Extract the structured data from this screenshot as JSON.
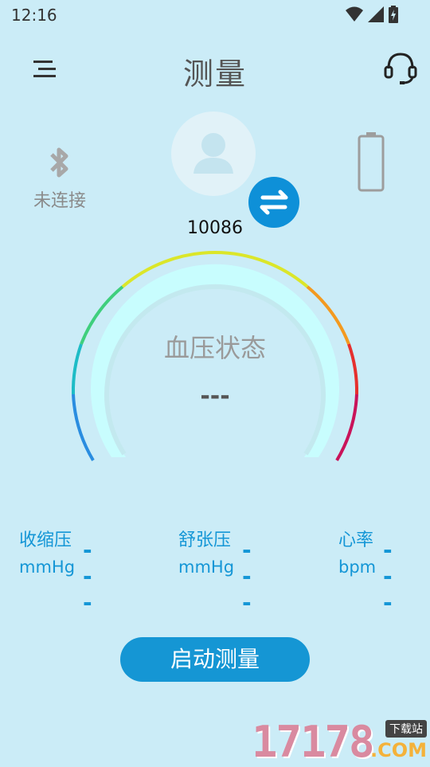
{
  "status_bar": {
    "time": "12:16"
  },
  "header": {
    "title": "测量"
  },
  "bluetooth": {
    "label": "未连接"
  },
  "user": {
    "id": "10086"
  },
  "gauge": {
    "status_label": "血压状态",
    "value": "---"
  },
  "metrics": [
    {
      "name": "收缩压",
      "unit": "mmHg",
      "value": "---"
    },
    {
      "name": "舒张压",
      "unit": "mmHg",
      "value": "---"
    },
    {
      "name": "心率",
      "unit": "bpm",
      "value": "---"
    }
  ],
  "start_button": {
    "label": "启动测量"
  },
  "watermark": {
    "digits": "17178",
    "tag": "下载站",
    "suffix": ".COM"
  },
  "colors": {
    "accent": "#1496d6",
    "background": "#cbecf7"
  },
  "icons": [
    "menu-icon",
    "headset-icon",
    "bluetooth-icon",
    "user-icon",
    "swap-icon",
    "battery-icon",
    "wifi-icon",
    "signal-icon"
  ]
}
